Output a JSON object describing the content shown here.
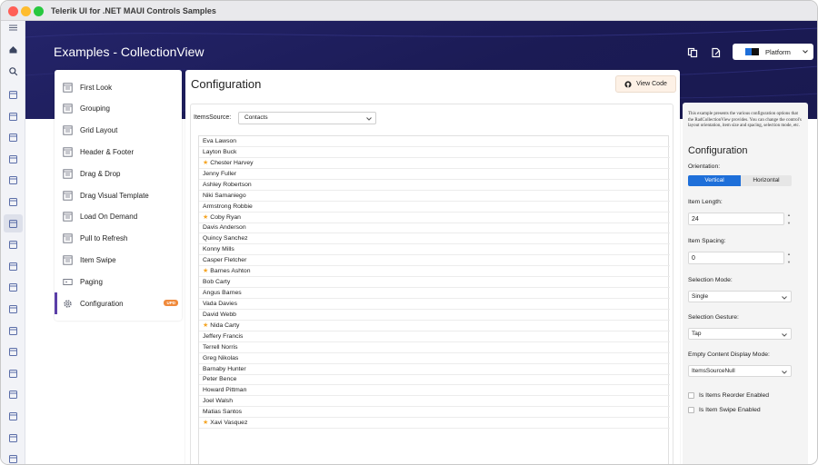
{
  "window": {
    "title": "Telerik UI for .NET MAUI Controls Samples"
  },
  "header": {
    "title": "Examples - CollectionView",
    "platform_label": "Platform"
  },
  "rail": {
    "icons": [
      "menu-icon",
      "home-icon",
      "search-icon",
      "calendar-icon",
      "bar-chart-icon",
      "column-chart-icon",
      "chat-icon",
      "checkbox-icon",
      "gauge-icon",
      "collectionview-icon",
      "dataform-icon",
      "datagrid-icon",
      "grid-icon",
      "entry-icon",
      "calendar-view-icon",
      "layout-icon",
      "panel-icon",
      "list-icon",
      "masked-input-icon",
      "tabview-icon",
      "ring-icon"
    ]
  },
  "nav": {
    "items": [
      {
        "label": "First Look",
        "icon": "window-icon"
      },
      {
        "label": "Grouping",
        "icon": "window-icon"
      },
      {
        "label": "Grid Layout",
        "icon": "window-icon"
      },
      {
        "label": "Header & Footer",
        "icon": "window-icon"
      },
      {
        "label": "Drag & Drop",
        "icon": "window-icon"
      },
      {
        "label": "Drag Visual Template",
        "icon": "window-icon"
      },
      {
        "label": "Load On Demand",
        "icon": "window-icon"
      },
      {
        "label": "Pull to Refresh",
        "icon": "window-icon"
      },
      {
        "label": "Item Swipe",
        "icon": "window-icon"
      },
      {
        "label": "Paging",
        "icon": "paging-icon"
      },
      {
        "label": "Configuration",
        "icon": "gear-icon",
        "badge": "UPD"
      }
    ]
  },
  "main": {
    "title": "Configuration",
    "view_code": "View Code",
    "items_source_label": "ItemsSource:",
    "items_source_value": "Contacts",
    "contacts": [
      {
        "name": "Eva Lawson",
        "fav": false
      },
      {
        "name": "Layton Buck",
        "fav": false
      },
      {
        "name": "Chester Harvey",
        "fav": true
      },
      {
        "name": "Jenny Fuller",
        "fav": false
      },
      {
        "name": "Ashley Robertson",
        "fav": false
      },
      {
        "name": "Niki Samaniego",
        "fav": false
      },
      {
        "name": "Armstrong Robbie",
        "fav": false
      },
      {
        "name": "Coby Ryan",
        "fav": true
      },
      {
        "name": "Davis Anderson",
        "fav": false
      },
      {
        "name": "Quincy Sanchez",
        "fav": false
      },
      {
        "name": "Konny Mills",
        "fav": false
      },
      {
        "name": "Casper Fletcher",
        "fav": false
      },
      {
        "name": "Barnes Ashton",
        "fav": true
      },
      {
        "name": "Bob Carty",
        "fav": false
      },
      {
        "name": "Angus Barnes",
        "fav": false
      },
      {
        "name": "Vada Davies",
        "fav": false
      },
      {
        "name": "David Webb",
        "fav": false
      },
      {
        "name": "Nida Carty",
        "fav": true
      },
      {
        "name": "Jeffery Francis",
        "fav": false
      },
      {
        "name": "Terrell Norris",
        "fav": false
      },
      {
        "name": "Greg Nikolas",
        "fav": false
      },
      {
        "name": "Barnaby Hunter",
        "fav": false
      },
      {
        "name": "Peter Bence",
        "fav": false
      },
      {
        "name": "Howard Pittman",
        "fav": false
      },
      {
        "name": "Joel Walsh",
        "fav": false
      },
      {
        "name": "Matias Santos",
        "fav": false
      },
      {
        "name": "Xavi Vasquez",
        "fav": true
      }
    ]
  },
  "settings": {
    "description": "This example presents the various configuration options that the RadCollectionView provides. You can change the control's layout orientation, item size and spacing, selection mode, etc.",
    "title": "Configuration",
    "orientation_label": "Orientation:",
    "orientation_vertical": "Vertical",
    "orientation_horizontal": "Horizontal",
    "item_length_label": "Item Length:",
    "item_length_value": "24",
    "item_spacing_label": "Item Spacing:",
    "item_spacing_value": "0",
    "selection_mode_label": "Selection Mode:",
    "selection_mode_value": "Single",
    "selection_gesture_label": "Selection Gesture:",
    "selection_gesture_value": "Tap",
    "empty_mode_label": "Empty Content Display Mode:",
    "empty_mode_value": "ItemsSourceNull",
    "reorder_label": "Is Items Reorder Enabled",
    "swipe_label": "Is Item Swipe Enabled"
  },
  "colors": {
    "header_bg": "#1d1d5a",
    "accent_blue": "#1e6fd9",
    "active_nav": "#5b3fa8",
    "star": "#f5a524",
    "badge": "#f08a3b"
  }
}
